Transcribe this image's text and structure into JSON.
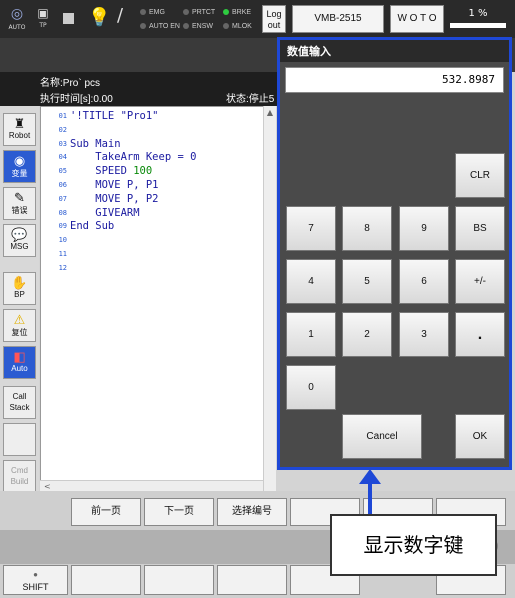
{
  "top": {
    "auto_label": "AUTO",
    "tp_label": "TP",
    "lamps": [
      {
        "label": "EMG",
        "on": false
      },
      {
        "label": "AUTO EN",
        "on": false
      },
      {
        "label": "PRTCT",
        "on": false
      },
      {
        "label": "ENSW",
        "on": false
      },
      {
        "label": "BRKE",
        "on": true
      },
      {
        "label": "MLOK",
        "on": false
      }
    ],
    "logout_label": "Log\nout",
    "robot_name": "VMB-2515",
    "woto_label": "W O T O",
    "speed": "1 %"
  },
  "info": {
    "program_name": "名称:Pro` pcs",
    "exec_time": "执行时间[s]:0.00",
    "status": "状态:停止5"
  },
  "sidebar": [
    {
      "label": "Robot",
      "icon": "robot-icon"
    },
    {
      "label": "变量",
      "icon": "variable-icon"
    },
    {
      "label": "错误",
      "icon": "error-icon"
    },
    {
      "label": "MSG",
      "icon": "message-icon"
    },
    {
      "label": "BP",
      "icon": "hand-icon"
    },
    {
      "label": "复位",
      "icon": "warning-icon"
    },
    {
      "label": "Auto",
      "icon": "auto-icon"
    },
    {
      "label": "Call Stack",
      "icon": ""
    },
    {
      "label": "",
      "icon": ""
    },
    {
      "label": "Cmd Build",
      "icon": ""
    }
  ],
  "editor": {
    "lines": [
      {
        "no": "01",
        "text": "'!TITLE \"Pro1\""
      },
      {
        "no": "02",
        "text": ""
      },
      {
        "no": "03",
        "text": "Sub Main"
      },
      {
        "no": "04",
        "text": "    TakeArm Keep = 0"
      },
      {
        "no": "05",
        "text": "    SPEED 100"
      },
      {
        "no": "06",
        "text": "    MOVE P, P1"
      },
      {
        "no": "07",
        "text": "    MOVE P, P2"
      },
      {
        "no": "08",
        "text": "    GIVEARM"
      },
      {
        "no": "09",
        "text": "End Sub"
      },
      {
        "no": "10",
        "text": ""
      },
      {
        "no": "11",
        "text": ""
      },
      {
        "no": "12",
        "text": ""
      }
    ]
  },
  "bottom": {
    "prev_page": "前一页",
    "next_page": "下一页",
    "select_number": "选择编号",
    "shift": "SHIFT"
  },
  "dialog": {
    "title": "数值输入",
    "value": "532.8987",
    "keys": {
      "clr": "CLR",
      "k7": "7",
      "k8": "8",
      "k9": "9",
      "bs": "BS",
      "k4": "4",
      "k5": "5",
      "k6": "6",
      "sign": "+/-",
      "k1": "1",
      "k2": "2",
      "k3": "3",
      "dot": ".",
      "k0": "0",
      "cancel": "Cancel",
      "ok": "OK"
    }
  },
  "annotation": {
    "text": "显示数字键",
    "color": "#1e48d6"
  }
}
